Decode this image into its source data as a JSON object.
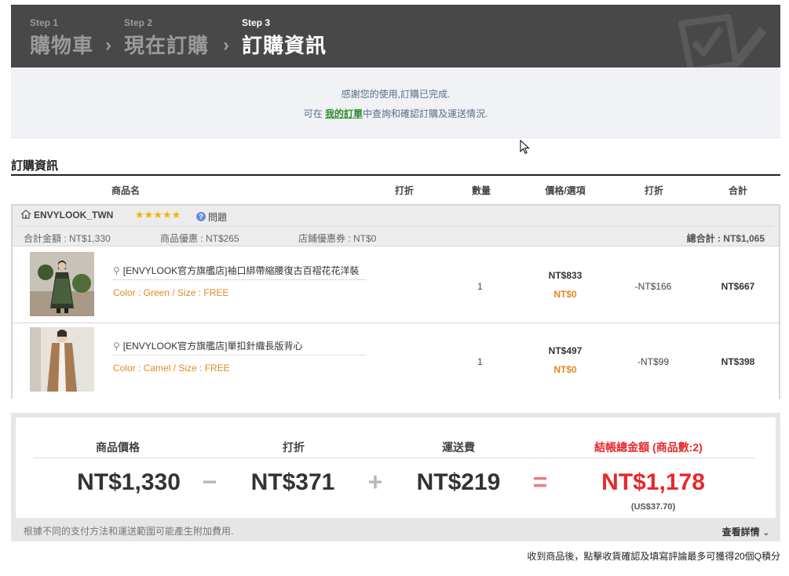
{
  "steps": [
    {
      "num": "Step 1",
      "name": "購物車"
    },
    {
      "num": "Step 2",
      "name": "現在訂購"
    },
    {
      "num": "Step 3",
      "name": "訂購資訊"
    }
  ],
  "step_arrow": "›",
  "notice": {
    "line1": "感謝您的使用,訂購已完成.",
    "line2_prefix": "可在 ",
    "line2_link": "我的訂單",
    "line2_suffix": "中查詢和確認訂購及運送情況."
  },
  "section_title": "訂購資訊",
  "table_headers": [
    "商品名",
    "打折",
    "數量",
    "價格/選項",
    "打折",
    "合計"
  ],
  "shop": {
    "name": "ENVYLOOK_TWN",
    "stars": "★★★★★",
    "question_label": "問題",
    "question_mark": "?",
    "subtotal": "合計金額 : NT$1,330",
    "item_discount": "商品優惠 : NT$265",
    "coupon": "店鋪優惠券 : NT$0",
    "grand_total": "總合計 : NT$1,065"
  },
  "items": [
    {
      "name": "[ENVYLOOK官方旗艦店]袖口綁帶縮腰復古百褶花花洋裝",
      "option": "Color : Green / Size : FREE",
      "qty": "1",
      "price": "NT$833",
      "option_price": "NT$0",
      "discount": "-NT$166",
      "subtotal": "NT$667"
    },
    {
      "name": "[ENVYLOOK官方旗艦店]單扣針織長版背心",
      "option": "Color : Camel / Size : FREE",
      "qty": "1",
      "price": "NT$497",
      "option_price": "NT$0",
      "discount": "-NT$99",
      "subtotal": "NT$398"
    }
  ],
  "summary": {
    "labels": {
      "price": "商品價格",
      "discount": "打折",
      "shipping": "運送費",
      "total": "結帳總金額 (商品數:2)"
    },
    "values": {
      "price": "NT$1,330",
      "discount": "NT$371",
      "shipping": "NT$219",
      "total": "NT$1,178",
      "total_usd": "(US$37.70)"
    },
    "ops": {
      "minus": "−",
      "plus": "+",
      "equals": "="
    },
    "note": "根據不同的支付方法和運送範圍可能產生附加費用.",
    "detail_label": "查看詳情",
    "detail_chevron": "⌄"
  },
  "footer_note": "收到商品後，點擊收貨確認及填寫評論最多可獲得20個Q積分",
  "colors": {
    "header_bg": "#484848",
    "accent_orange": "#e08a1e",
    "total_red": "#e8282c",
    "link_green": "#2e8b2e",
    "star_gold": "#f0b400"
  }
}
